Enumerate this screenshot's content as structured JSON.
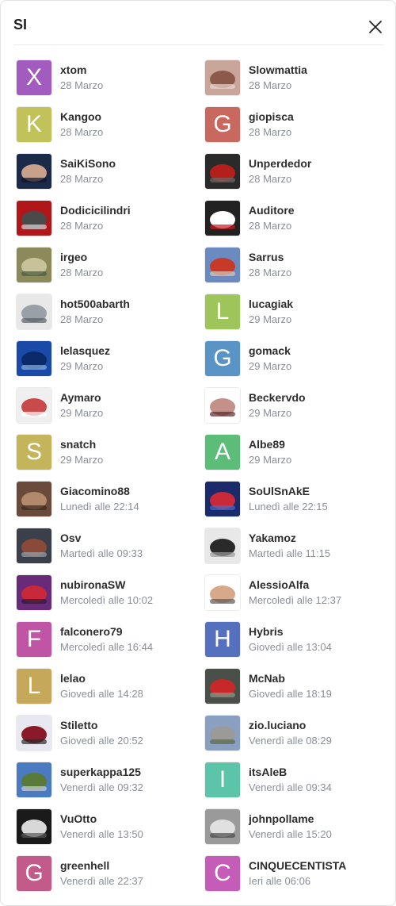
{
  "header": {
    "title": "SI",
    "close_icon": "close-icon"
  },
  "users": [
    {
      "name": "xtom",
      "date": "28 Marzo",
      "avatar": {
        "type": "letter",
        "letter": "X",
        "color": "#a25cc0"
      }
    },
    {
      "name": "Slowmattia",
      "date": "28 Marzo",
      "avatar": {
        "type": "photo",
        "palette": [
          "#c9a59a",
          "#8c5a4a",
          "#e8d6cf"
        ]
      }
    },
    {
      "name": "Kangoo",
      "date": "28 Marzo",
      "avatar": {
        "type": "letter",
        "letter": "K",
        "color": "#c2c25a"
      }
    },
    {
      "name": "giopisca",
      "date": "28 Marzo",
      "avatar": {
        "type": "letter",
        "letter": "G",
        "color": "#c9685e"
      }
    },
    {
      "name": "SaiKiSono",
      "date": "28 Marzo",
      "avatar": {
        "type": "photo",
        "palette": [
          "#1c2a4a",
          "#c9a08a",
          "#0d1426"
        ]
      }
    },
    {
      "name": "Unperdedor",
      "date": "28 Marzo",
      "avatar": {
        "type": "photo",
        "palette": [
          "#2a2a2a",
          "#b3201c",
          "#6a6a6a"
        ]
      }
    },
    {
      "name": "Dodicicilindri",
      "date": "28 Marzo",
      "avatar": {
        "type": "photo",
        "palette": [
          "#b1161b",
          "#4a4a4a",
          "#d8d8d8"
        ]
      }
    },
    {
      "name": "Auditore",
      "date": "28 Marzo",
      "avatar": {
        "type": "photo",
        "palette": [
          "#222222",
          "#ffffff",
          "#c9181f"
        ]
      }
    },
    {
      "name": "irgeo",
      "date": "28 Marzo",
      "avatar": {
        "type": "photo",
        "palette": [
          "#8c8a5a",
          "#c8c29a",
          "#4a5a3a"
        ]
      }
    },
    {
      "name": "Sarrus",
      "date": "28 Marzo",
      "avatar": {
        "type": "photo",
        "palette": [
          "#6a8ac0",
          "#c73a2a",
          "#d8c9b8"
        ]
      }
    },
    {
      "name": "hot500abarth",
      "date": "28 Marzo",
      "avatar": {
        "type": "photo",
        "palette": [
          "#e8e8e8",
          "#9aa0a8",
          "#5a5f66"
        ]
      }
    },
    {
      "name": "lucagiak",
      "date": "29 Marzo",
      "avatar": {
        "type": "letter",
        "letter": "L",
        "color": "#9ec55a"
      }
    },
    {
      "name": "lelasquez",
      "date": "29 Marzo",
      "avatar": {
        "type": "photo",
        "palette": [
          "#1a4aa8",
          "#0b2a6a",
          "#8ab0e0"
        ]
      }
    },
    {
      "name": "gomack",
      "date": "29 Marzo",
      "avatar": {
        "type": "letter",
        "letter": "G",
        "color": "#5a93c6"
      }
    },
    {
      "name": "Aymaro",
      "date": "29 Marzo",
      "avatar": {
        "type": "photo",
        "palette": [
          "#efefef",
          "#c84a4a",
          "#ffffff"
        ]
      }
    },
    {
      "name": "Beckervdo",
      "date": "29 Marzo",
      "avatar": {
        "type": "photo",
        "palette": [
          "#ffffff",
          "#c4908a",
          "#5a2a2a"
        ]
      }
    },
    {
      "name": "snatch",
      "date": "29 Marzo",
      "avatar": {
        "type": "letter",
        "letter": "S",
        "color": "#c4b45a"
      }
    },
    {
      "name": "Albe89",
      "date": "29 Marzo",
      "avatar": {
        "type": "letter",
        "letter": "A",
        "color": "#5cbd78"
      }
    },
    {
      "name": "Giacomino88",
      "date": "Lunedì alle 22:14",
      "avatar": {
        "type": "photo",
        "palette": [
          "#6a4a3a",
          "#b08a6a",
          "#3a2a20"
        ]
      }
    },
    {
      "name": "SoUlSnAkE",
      "date": "Lunedì alle 22:15",
      "avatar": {
        "type": "photo",
        "palette": [
          "#1a2a6a",
          "#c92a3a",
          "#4a6ac8"
        ]
      }
    },
    {
      "name": "Osv",
      "date": "Martedì alle 09:33",
      "avatar": {
        "type": "photo",
        "palette": [
          "#3a3f4a",
          "#8a4a3a",
          "#9aa0a8"
        ]
      }
    },
    {
      "name": "Yakamoz",
      "date": "Martedì alle 11:15",
      "avatar": {
        "type": "photo",
        "palette": [
          "#e8e8e8",
          "#2a2a2a",
          "#9a9a9a"
        ]
      }
    },
    {
      "name": "nubironaSW",
      "date": "Mercoledì alle 10:02",
      "avatar": {
        "type": "photo",
        "palette": [
          "#6a2a7a",
          "#c9283a",
          "#2a1a3a"
        ]
      }
    },
    {
      "name": "AlessioAlfa",
      "date": "Mercoledì alle 12:37",
      "avatar": {
        "type": "photo",
        "palette": [
          "#ffffff",
          "#d8a88a",
          "#5a5a5a"
        ]
      }
    },
    {
      "name": "falconero79",
      "date": "Mercoledì alle 16:44",
      "avatar": {
        "type": "letter",
        "letter": "F",
        "color": "#c054a5"
      }
    },
    {
      "name": "Hybris",
      "date": "Giovedì alle 13:04",
      "avatar": {
        "type": "letter",
        "letter": "H",
        "color": "#5670c0"
      }
    },
    {
      "name": "lelao",
      "date": "Giovedì alle 14:28",
      "avatar": {
        "type": "letter",
        "letter": "L",
        "color": "#c6a85a"
      }
    },
    {
      "name": "McNab",
      "date": "Giovedì alle 18:19",
      "avatar": {
        "type": "photo",
        "palette": [
          "#4a4f4a",
          "#c9282a",
          "#8a9a8a"
        ]
      }
    },
    {
      "name": "Stiletto",
      "date": "Giovedì alle 20:52",
      "avatar": {
        "type": "photo",
        "palette": [
          "#e8e8f0",
          "#8a1a2a",
          "#2a2a2a"
        ]
      }
    },
    {
      "name": "zio.luciano",
      "date": "Venerdì alle 08:29",
      "avatar": {
        "type": "photo",
        "palette": [
          "#8aa0c0",
          "#9a9a9a",
          "#5a6a4a"
        ]
      }
    },
    {
      "name": "superkappa125",
      "date": "Venerdì alle 09:32",
      "avatar": {
        "type": "photo",
        "palette": [
          "#4a7ac0",
          "#5a7a3a",
          "#c8d0d8"
        ]
      }
    },
    {
      "name": "itsAleB",
      "date": "Venerdì alle 09:34",
      "avatar": {
        "type": "letter",
        "letter": "I",
        "color": "#5cc4a8"
      }
    },
    {
      "name": "VuOtto",
      "date": "Venerdì alle 13:50",
      "avatar": {
        "type": "photo",
        "palette": [
          "#1a1a1a",
          "#d8d8d8",
          "#5a5a5a"
        ]
      }
    },
    {
      "name": "johnpollame",
      "date": "Venerdì alle 15:20",
      "avatar": {
        "type": "photo",
        "palette": [
          "#9a9a9a",
          "#e0e0e0",
          "#4a4a4a"
        ]
      }
    },
    {
      "name": "greenhell",
      "date": "Venerdì alle 22:37",
      "avatar": {
        "type": "letter",
        "letter": "G",
        "color": "#c25a8a"
      }
    },
    {
      "name": "CINQUECENTISTA",
      "date": "Ieri alle 06:06",
      "avatar": {
        "type": "letter",
        "letter": "C",
        "color": "#c45cb8"
      }
    }
  ]
}
